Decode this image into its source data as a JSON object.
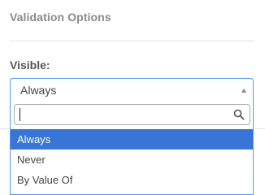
{
  "section": {
    "title": "Validation Options"
  },
  "visible_field": {
    "label": "Visible:",
    "selected_value": "Always",
    "search": {
      "value": "",
      "placeholder": "",
      "icon": "search-icon"
    },
    "options": [
      {
        "label": "Always",
        "highlighted": true
      },
      {
        "label": "Never",
        "highlighted": false
      },
      {
        "label": "By Value Of",
        "highlighted": false
      }
    ]
  },
  "colors": {
    "accent_border": "#5897fb",
    "highlight_bg": "#3875d7",
    "highlight_text": "#ffffff"
  }
}
